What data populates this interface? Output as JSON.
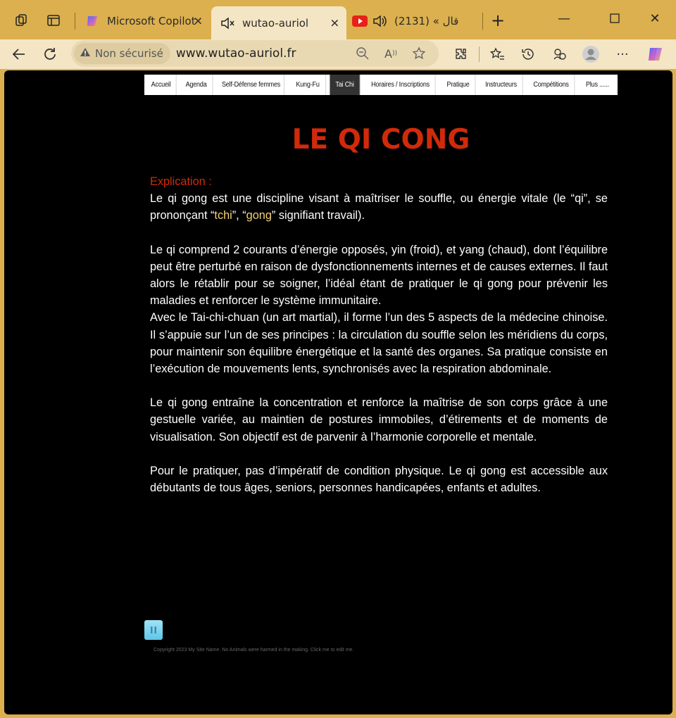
{
  "browser": {
    "tabs": [
      {
        "title": "Microsoft Copilot",
        "active": false
      },
      {
        "title": "wutao-auriol",
        "active": true
      },
      {
        "title": "قال » (2131)",
        "active": false
      }
    ],
    "address": {
      "security_label": "Non sécurisé",
      "url": "www.wutao-auriol.fr"
    },
    "accent_color": "#dcb04e"
  },
  "site": {
    "nav": [
      {
        "label": "Accueil",
        "active": false
      },
      {
        "label": "Agenda",
        "active": false
      },
      {
        "label": "Self-Défense femmes",
        "active": false
      },
      {
        "label": "Kung-Fu",
        "active": false
      },
      {
        "label": "Tai Chi",
        "active": true
      },
      {
        "label": "Horaires / Inscriptions",
        "active": false
      },
      {
        "label": "Pratique",
        "active": false
      },
      {
        "label": "Instructeurs",
        "active": false
      },
      {
        "label": "Compétitions",
        "active": false
      },
      {
        "label": "Plus ......",
        "active": false
      }
    ],
    "page_title": "LE QI CONG",
    "explication_label": "Explication :",
    "p1_before": "Le qi gong est une discipline visant à maîtriser le souffle, ou énergie vitale (le “qi”, se prononçant “",
    "p1_tchi": "tchi",
    "p1_mid": "”, “",
    "p1_gong": "gong",
    "p1_after": "” signifiant travail).",
    "p2": "Le qi comprend 2 courants d’énergie opposés, yin (froid), et yang (chaud), dont l’équilibre peut être perturbé en raison de dysfonctionnements internes et de causes externes. Il faut alors le rétablir pour se soigner, l’idéal étant de pratiquer le qi gong pour prévenir les maladies et renforcer le système immunitaire.",
    "p3": "Avec le Tai-chi-chuan (un art martial), il forme l’un des 5 aspects de la médecine chinoise. Il s’appuie sur l’un de ses principes : la circulation du souffle selon les méridiens du corps, pour maintenir son équilibre énergétique et la santé des organes. Sa pratique consiste en l’exécution de mouvements lents, synchronisés avec la respiration abdominale.",
    "p4": "Le qi gong entraîne la concentration et renforce la maîtrise de son corps grâce à une gestuelle variée, au maintien de postures immobiles, d’étirements et de moments de visualisation. Son objectif est de parvenir à l’harmonie corporelle et mentale.",
    "p5": "Pour le pratiquer, pas d’impératif de condition physique. Le qi gong est accessible aux débutants de tous âges, seniors, personnes handicapées, enfants et adultes.",
    "pause_icon": "pause-icon",
    "copyright": "Copyright 2023 My Site Name. No Animals were harmed in the making. Click me to edit me.",
    "title_color": "#d12a0a",
    "highlight_color": "#f2d27a"
  }
}
